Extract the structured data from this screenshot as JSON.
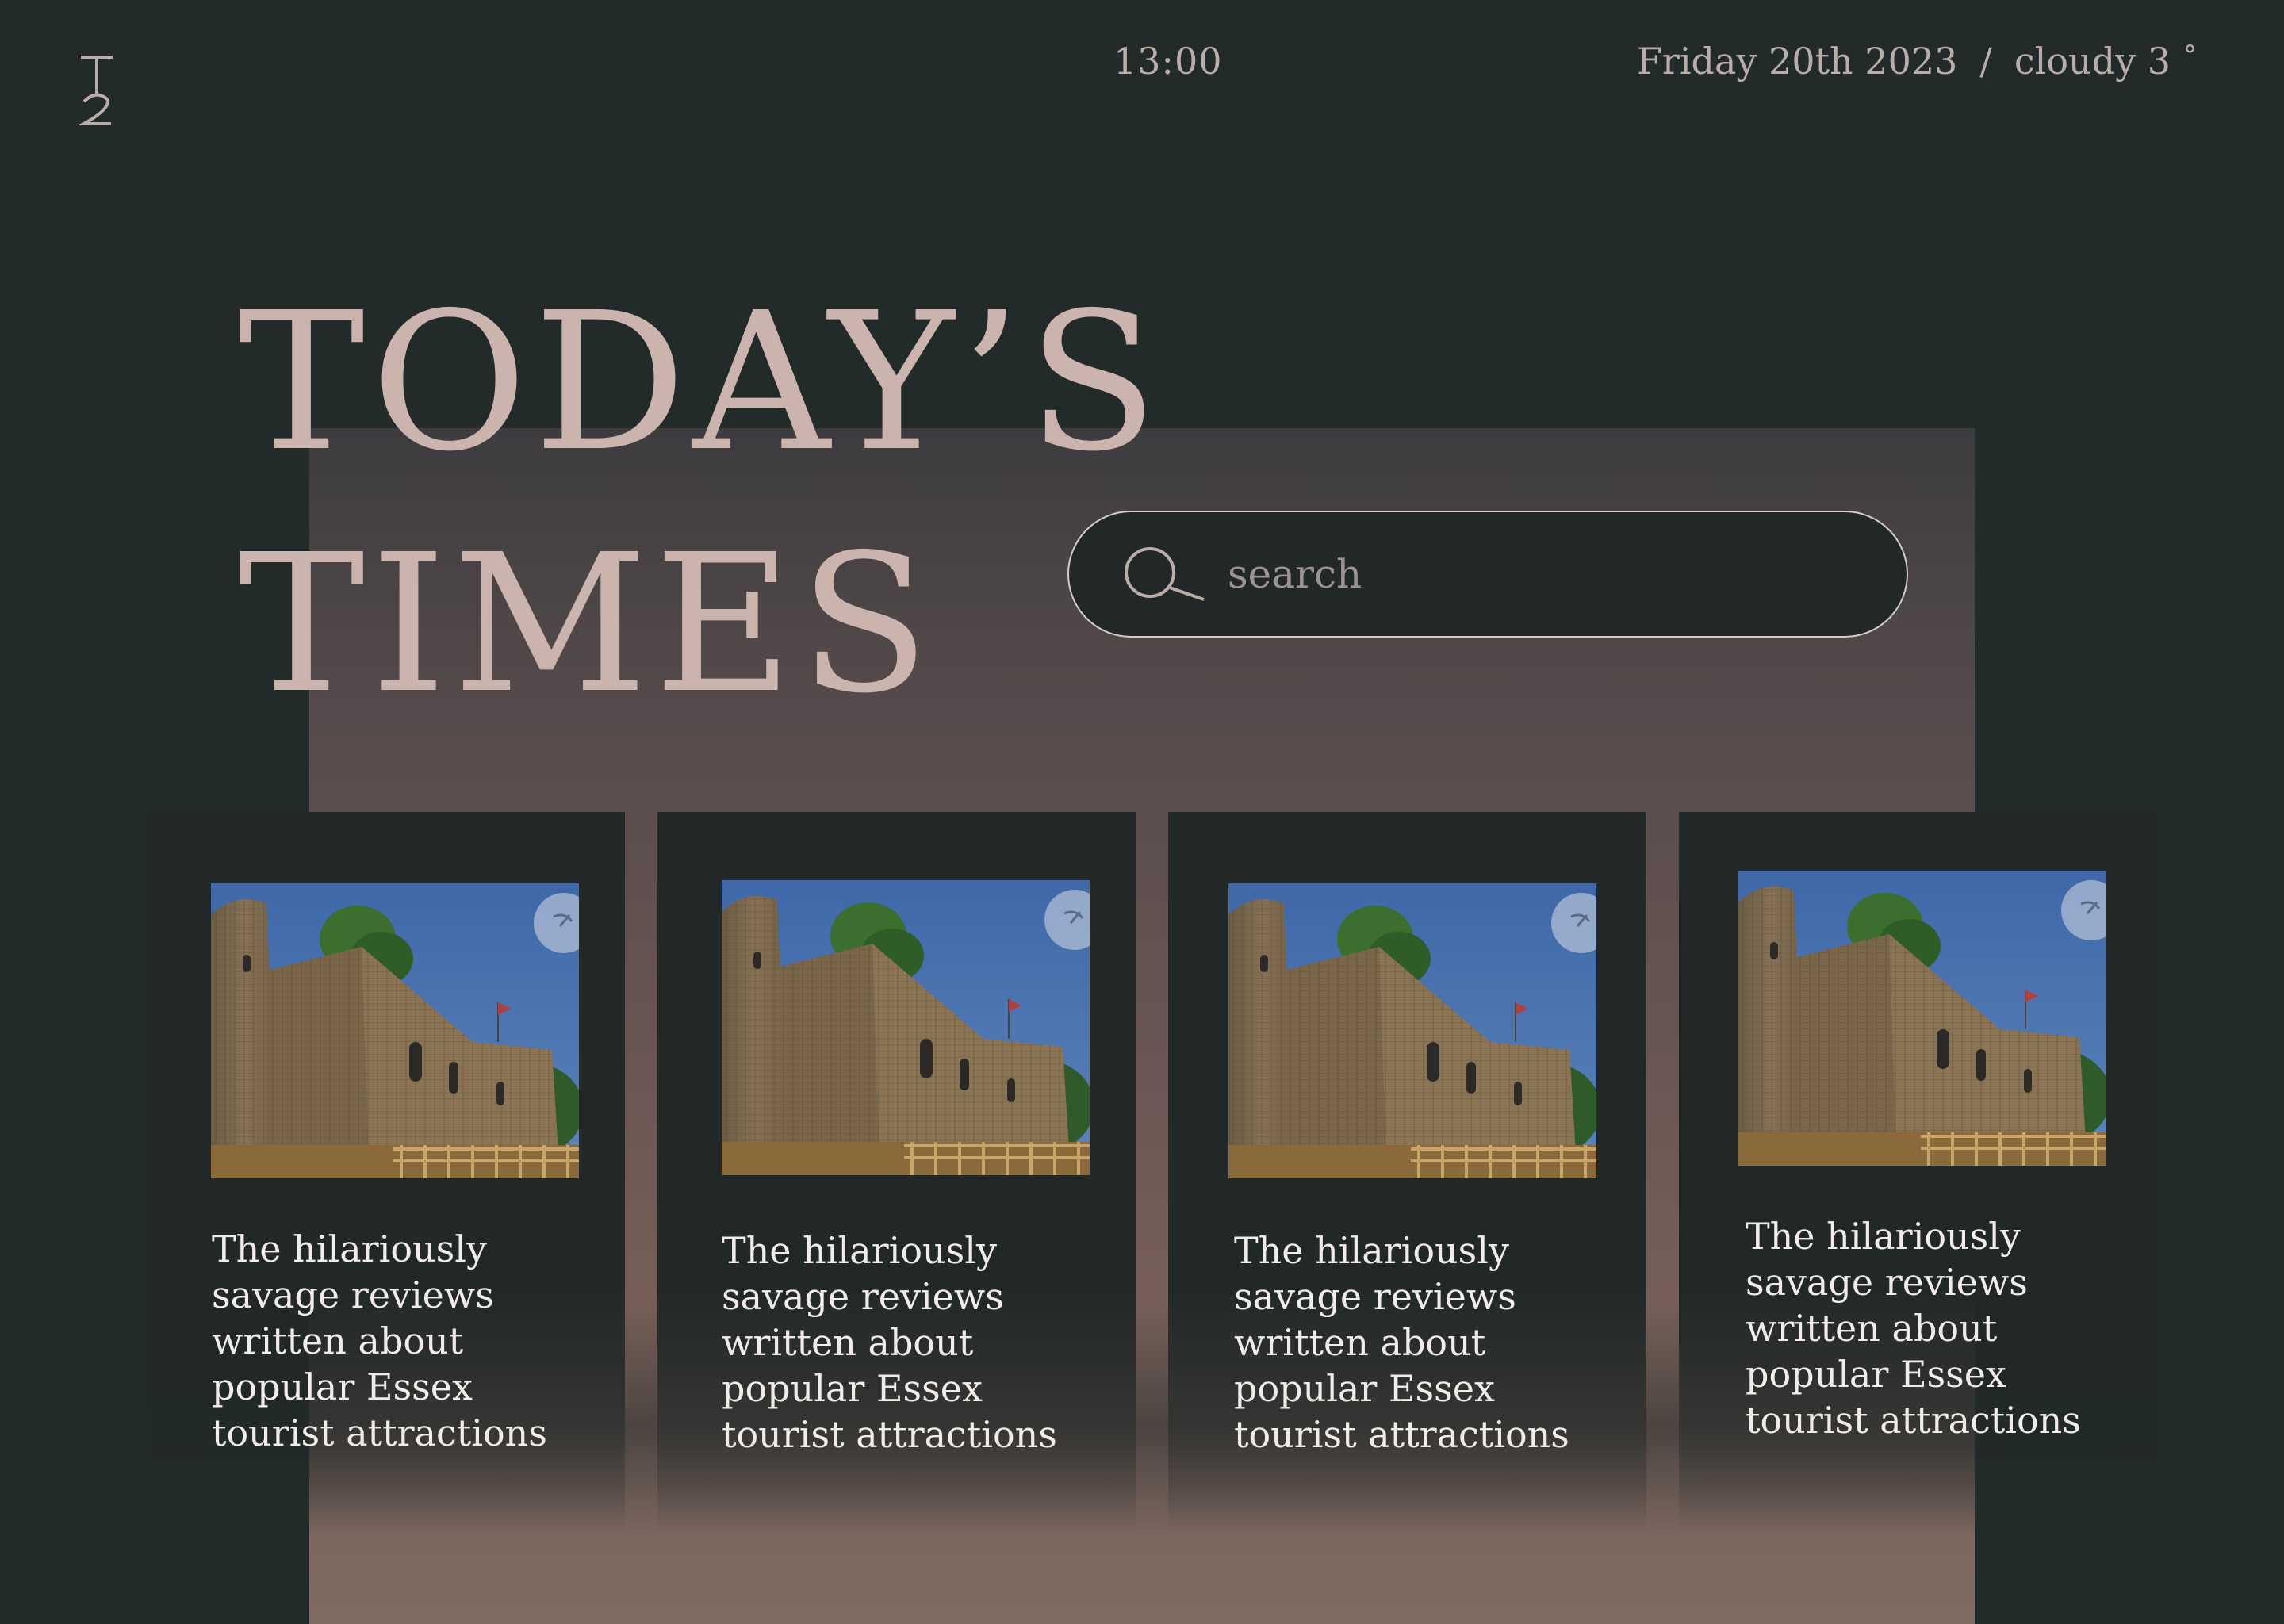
{
  "header": {
    "logo_text": "T2",
    "time": "13:00",
    "date": "Friday 20th 2023",
    "separator": "/",
    "weather": "cloudy 3",
    "degree_symbol": "°"
  },
  "hero": {
    "title_line1": "TODAY’S",
    "title_line2": "TIMES"
  },
  "search": {
    "placeholder": "search",
    "value": "",
    "icon": "search-icon"
  },
  "cards": [
    {
      "title": "The hilariously savage reviews written about popular Essex tourist attractions",
      "image": "castle-photo",
      "badge_icon": "leaf-icon"
    },
    {
      "title": "The hilariously savage reviews written about popular Essex tourist attractions",
      "image": "castle-photo",
      "badge_icon": "leaf-icon"
    },
    {
      "title": "The hilariously savage reviews written about popular Essex tourist attractions",
      "image": "castle-photo",
      "badge_icon": "leaf-icon"
    },
    {
      "title": "The hilariously savage reviews written about popular Essex tourist attractions",
      "image": "castle-photo",
      "badge_icon": "leaf-icon"
    }
  ],
  "colors": {
    "background": "#232a2a",
    "band_top": "#3d3c3f",
    "band_bottom": "#7e6b62",
    "headline": "#cbb3ae",
    "card_text": "#f1ece9"
  }
}
